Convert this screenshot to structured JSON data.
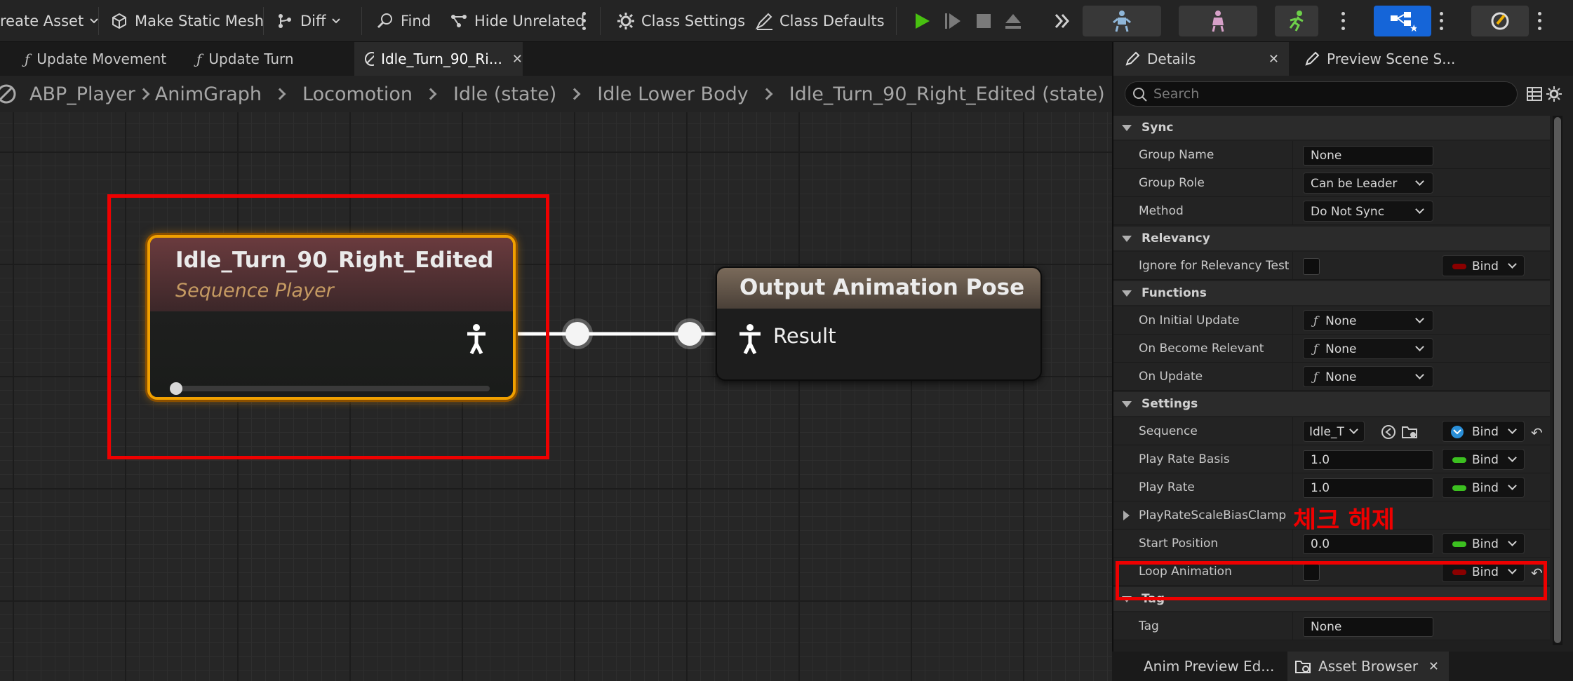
{
  "toolbar": {
    "create_asset": "reate Asset",
    "make_static_mesh": "Make Static Mesh",
    "diff": "Diff",
    "find": "Find",
    "hide_unrelated": "Hide Unrelated",
    "class_settings": "Class Settings",
    "class_defaults": "Class Defaults"
  },
  "tabs": [
    {
      "label": "Update Movement"
    },
    {
      "label": "Update Turn"
    },
    {
      "label": "Idle_Turn_90_Ri..."
    }
  ],
  "breadcrumb": [
    "ABP_Player",
    "AnimGraph",
    "Locomotion",
    "Idle (state)",
    "Idle Lower Body",
    "Idle_Turn_90_Right_Edited (state)"
  ],
  "graph": {
    "node1": {
      "title": "Idle_Turn_90_Right_Edited",
      "subtitle": "Sequence Player",
      "progress": 0.0
    },
    "node2": {
      "title": "Output Animation Pose",
      "pin": "Result"
    }
  },
  "details": {
    "tab_details": "Details",
    "tab_preview": "Preview Scene S...",
    "search_placeholder": "Search",
    "sections": {
      "sync": "Sync",
      "relevancy": "Relevancy",
      "functions": "Functions",
      "settings": "Settings",
      "tag": "Tag"
    },
    "labels": {
      "group_name": "Group Name",
      "group_role": "Group Role",
      "method": "Method",
      "ignore_relevancy": "Ignore for Relevancy Test",
      "on_initial_update": "On Initial Update",
      "on_become_relevant": "On Become Relevant",
      "on_update": "On Update",
      "sequence": "Sequence",
      "play_rate_basis": "Play Rate Basis",
      "play_rate": "Play Rate",
      "play_rate_clamp": "PlayRateScaleBiasClamp",
      "start_position": "Start Position",
      "loop_animation": "Loop Animation",
      "tag": "Tag"
    },
    "values": {
      "group_name": "None",
      "group_role": "Can be Leader",
      "method": "Do Not Sync",
      "on_initial_update": "None",
      "on_become_relevant": "None",
      "on_update": "None",
      "sequence": "Idle_T",
      "play_rate_basis": "1.0",
      "play_rate": "1.0",
      "start_position": "0.0",
      "loop_animation": false,
      "ignore_relevancy": false,
      "tag": "None"
    },
    "bind_label": "Bind",
    "annotation": "체크 해제"
  },
  "bottom_tabs": {
    "anim_preview": "Anim Preview Ed...",
    "asset_browser": "Asset Browser"
  },
  "colors": {
    "accent_node": "#f0a000",
    "highlight": "#ee0000",
    "bind_red": "#8b0000",
    "bind_green": "#3cc020",
    "play_green": "#48c010",
    "blue_btn": "#1565d8"
  }
}
